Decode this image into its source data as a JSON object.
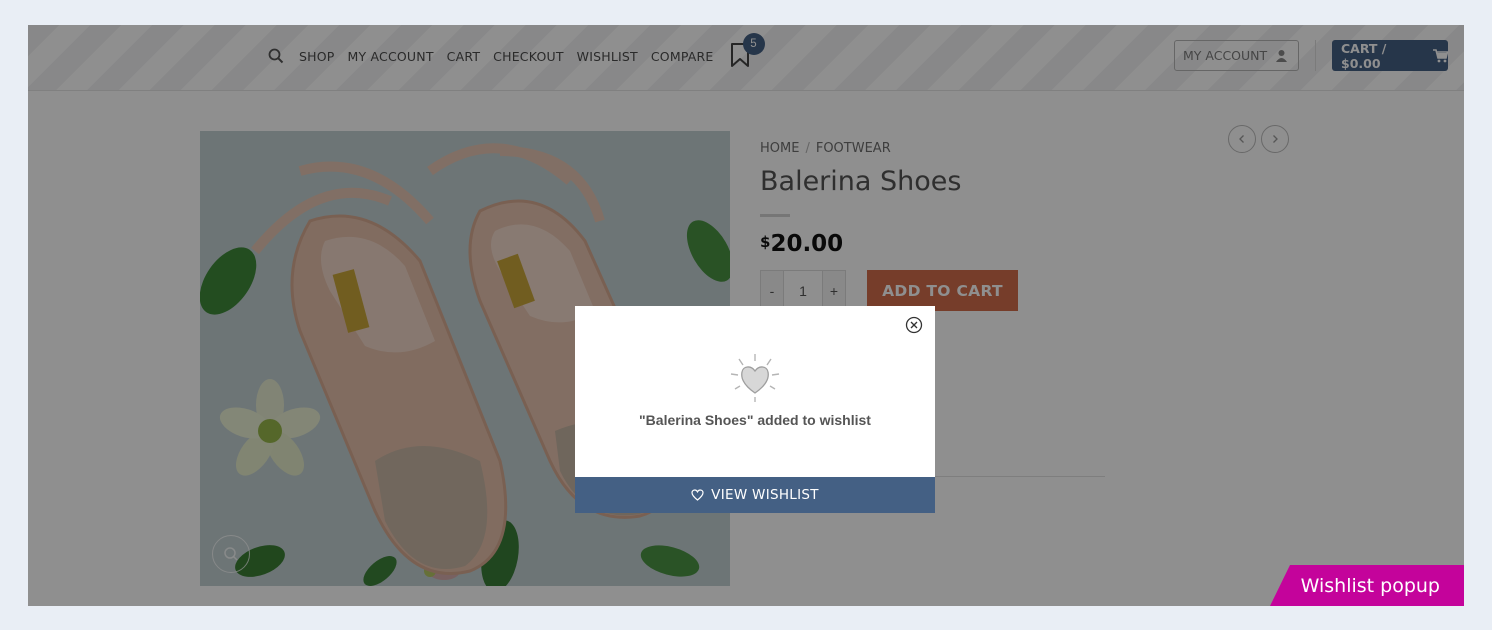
{
  "header": {
    "nav": [
      {
        "label": "SHOP"
      },
      {
        "label": "MY ACCOUNT"
      },
      {
        "label": "CART"
      },
      {
        "label": "CHECKOUT"
      },
      {
        "label": "WISHLIST"
      },
      {
        "label": "COMPARE"
      }
    ],
    "wishlist_count": "5",
    "account_button": "MY ACCOUNT",
    "cart_button": "CART / $0.00"
  },
  "product": {
    "breadcrumb": [
      "HOME",
      "FOOTWEAR"
    ],
    "breadcrumb_separator": "/",
    "title": "Balerina Shoes",
    "currency": "$",
    "price": "20.00",
    "quantity": {
      "minus": "-",
      "value": "1",
      "plus": "+"
    },
    "add_to_cart": "ADD TO CART"
  },
  "popup": {
    "message": "\"Balerina Shoes\" added to wishlist",
    "view_button": "VIEW WISHLIST"
  },
  "corner_label": "Wishlist popup",
  "colors": {
    "primary": "#446084",
    "add_to_cart": "#d26e4b",
    "corner_label": "#c4039b",
    "page_background": "#e9eef5"
  },
  "icons": [
    "search-icon",
    "bookmark-icon",
    "user-icon",
    "cart-icon",
    "zoom-icon",
    "chevron-left-icon",
    "chevron-right-icon",
    "close-circle-icon",
    "heart-icon"
  ]
}
